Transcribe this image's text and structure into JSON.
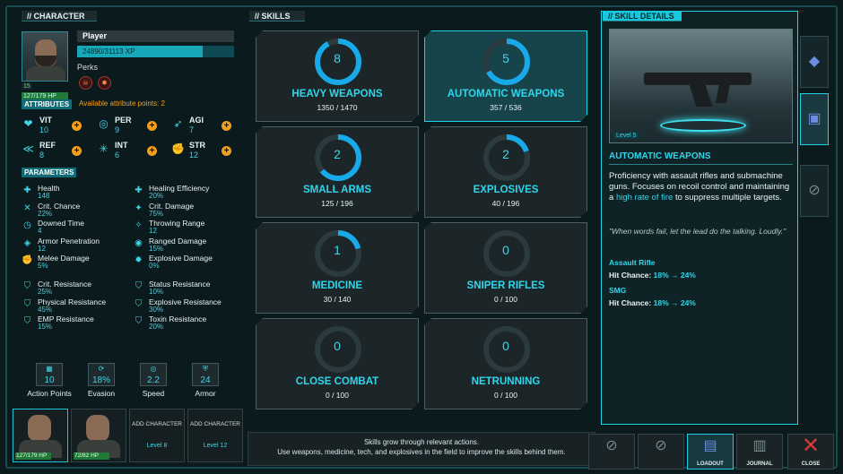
{
  "character": {
    "header": "// CHARACTER",
    "name": "Player",
    "xp": "24890/31113 XP",
    "xp_fraction": 0.8,
    "level": "15",
    "hp": "127/179 HP",
    "perks_label": "Perks",
    "attributes_label": "ATTRIBUTES",
    "available_points": "Available attribute points: 2",
    "attributes": [
      {
        "name": "VIT",
        "value": "10",
        "icon": "heart-icon"
      },
      {
        "name": "PER",
        "value": "9",
        "icon": "goggles-icon"
      },
      {
        "name": "AGI",
        "value": "7",
        "icon": "running-icon"
      },
      {
        "name": "REF",
        "value": "8",
        "icon": "reflex-icon"
      },
      {
        "name": "INT",
        "value": "6",
        "icon": "brain-icon"
      },
      {
        "name": "STR",
        "value": "12",
        "icon": "fist-icon"
      }
    ],
    "parameters_label": "PARAMETERS",
    "parameters": [
      {
        "name": "Health",
        "value": "148"
      },
      {
        "name": "Healing Efficiency",
        "value": "20%"
      },
      {
        "name": "Crit. Chance",
        "value": "22%"
      },
      {
        "name": "Crit. Damage",
        "value": "75%"
      },
      {
        "name": "Downed Time",
        "value": "4"
      },
      {
        "name": "Throwing Range",
        "value": "12"
      },
      {
        "name": "Armor Penetration",
        "value": "12"
      },
      {
        "name": "Ranged Damage",
        "value": "15%"
      },
      {
        "name": "Melee Damage",
        "value": "5%"
      },
      {
        "name": "Explosive Damage",
        "value": "0%"
      }
    ],
    "resistances": [
      {
        "name": "Crit. Resistance",
        "value": "25%"
      },
      {
        "name": "Status Resistance",
        "value": "10%"
      },
      {
        "name": "Physical Resistance",
        "value": "45%"
      },
      {
        "name": "Explosive Resistance",
        "value": "30%"
      },
      {
        "name": "EMP Resistance",
        "value": "15%"
      },
      {
        "name": "Toxin Resistance",
        "value": "20%"
      }
    ],
    "stats": [
      {
        "label": "Action Points",
        "value": "10"
      },
      {
        "label": "Evasion",
        "value": "18%"
      },
      {
        "label": "Speed",
        "value": "2.2"
      },
      {
        "label": "Armor",
        "value": "24"
      }
    ],
    "party": [
      {
        "hp": "127/179 HP"
      },
      {
        "hp": "72/82 HP"
      },
      {
        "add": "ADD CHARACTER",
        "level": "Level 8"
      },
      {
        "add": "ADD CHARACTER",
        "level": "Level 12"
      }
    ]
  },
  "skills": {
    "header": "// SKILLS",
    "items": [
      {
        "name": "HEAVY WEAPONS",
        "level": "8",
        "xp": "1350 / 1470",
        "progress": 0.92
      },
      {
        "name": "AUTOMATIC WEAPONS",
        "level": "5",
        "xp": "357 / 536",
        "progress": 0.67
      },
      {
        "name": "SMALL ARMS",
        "level": "2",
        "xp": "125 / 196",
        "progress": 0.64
      },
      {
        "name": "EXPLOSIVES",
        "level": "2",
        "xp": "40 / 196",
        "progress": 0.2
      },
      {
        "name": "MEDICINE",
        "level": "1",
        "xp": "30 / 140",
        "progress": 0.21
      },
      {
        "name": "SNIPER RIFLES",
        "level": "0",
        "xp": "0 / 100",
        "progress": 0
      },
      {
        "name": "CLOSE COMBAT",
        "level": "0",
        "xp": "0 / 100",
        "progress": 0
      },
      {
        "name": "NETRUNNING",
        "level": "0",
        "xp": "0 / 100",
        "progress": 0
      }
    ],
    "footer_line1": "Skills grow through relevant actions.",
    "footer_line2": "Use weapons, medicine, tech, and explosives in the field to improve the skills behind them."
  },
  "details": {
    "header": "// SKILL DETAILS",
    "image_level": "Level 5",
    "title": "AUTOMATIC WEAPONS",
    "desc_pre": "Proficiency with assault rifles and submachine guns. Focuses on recoil control and maintaining a ",
    "desc_hl": "high rate of fire",
    "desc_post": " to suppress multiple targets.",
    "quote": "\"When words fail, let the lead do the talking. Loudly.\"",
    "bonuses": [
      {
        "weapon": "Assault Rifle",
        "label": "Hit Chance:",
        "value": "18% → 24%"
      },
      {
        "weapon": "SMG",
        "label": "Hit Chance:",
        "value": "18% → 24%"
      }
    ]
  },
  "bottom": {
    "loadout": "LOADOUT",
    "journal": "JOURNAL",
    "close": "CLOSE"
  },
  "colors": {
    "accent": "#1fd3e6",
    "plus": "#f0a020"
  }
}
